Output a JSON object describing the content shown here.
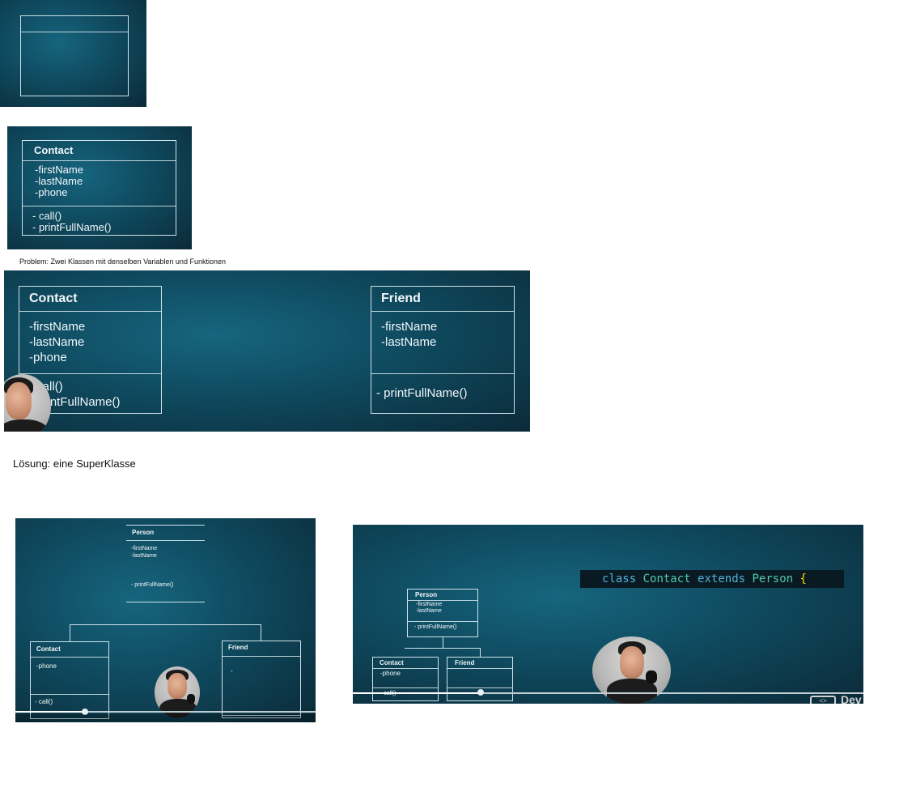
{
  "slide1": {
    "class_name": "",
    "attributes": [],
    "methods": []
  },
  "slide2": {
    "class_name": "Contact",
    "attributes": [
      "-firstName",
      "-lastName",
      "-phone"
    ],
    "methods": [
      "- call()",
      "- printFullName()"
    ]
  },
  "caption_problem": "Problem: Zwei Klassen mit denselben Variablen und Funktionen",
  "slide3": {
    "contact": {
      "class_name": "Contact",
      "attributes": [
        "-firstName",
        "-lastName",
        "-phone"
      ],
      "methods": [
        "- call()",
        "- printFullName()"
      ]
    },
    "friend": {
      "class_name": "Friend",
      "attributes": [
        "-firstName",
        "-lastName"
      ],
      "methods": [
        "- printFullName()"
      ]
    }
  },
  "caption_solution": "Lösung: eine SuperKlasse",
  "slide4": {
    "person": {
      "class_name": "Person",
      "attributes": [
        "-firstName",
        "-lastName"
      ],
      "methods": [
        "- printFullName()"
      ]
    },
    "contact": {
      "class_name": "Contact",
      "attributes": [
        "-phone"
      ],
      "methods": [
        "- call()"
      ]
    },
    "friend": {
      "class_name": "Friend",
      "attributes": [
        "-"
      ],
      "methods": []
    },
    "progress": 0.23
  },
  "slide5": {
    "code": {
      "kw_class": "class",
      "name_contact": "Contact",
      "kw_extends": "extends",
      "name_person": "Person",
      "brace": "{"
    },
    "person": {
      "class_name": "Person",
      "attributes": [
        "-firstName",
        "-lastName"
      ],
      "methods": [
        "- printFullName()"
      ]
    },
    "contact": {
      "class_name": "Contact",
      "attributes": [
        "-phone"
      ],
      "methods": [
        "- call()"
      ]
    },
    "friend": {
      "class_name": "Friend",
      "attributes": [],
      "methods": []
    },
    "watermark": "Dev",
    "progress": 0.25
  },
  "colors": {
    "keyword": "#4fb3d9",
    "type_name": "#4ec9b0",
    "brace": "#ffd700",
    "line": "#cfe3ea"
  }
}
